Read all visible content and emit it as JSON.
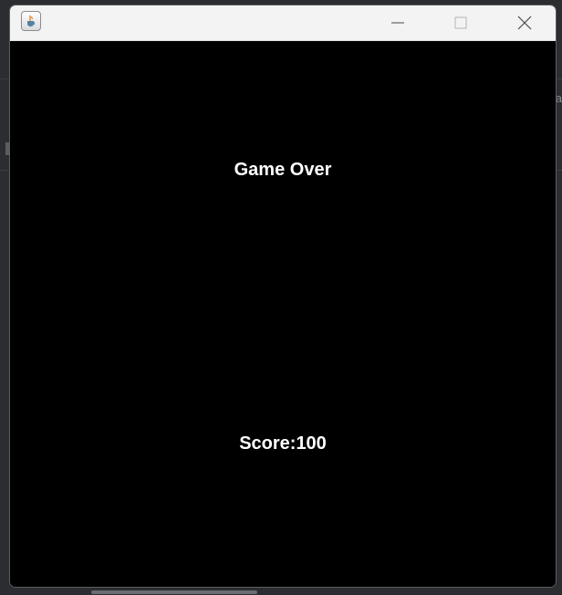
{
  "window": {
    "app_icon": "java-coffee-icon",
    "controls": {
      "minimize_icon": "minimize-icon",
      "maximize_icon": "maximize-icon",
      "close_icon": "close-icon"
    }
  },
  "game": {
    "message": "Game Over",
    "score_label": "Score:",
    "score_value": "100"
  },
  "background": {
    "right_edge_text": "a"
  },
  "colors": {
    "game_background": "#000000",
    "text": "#ffffff",
    "titlebar": "#f3f3f3"
  }
}
